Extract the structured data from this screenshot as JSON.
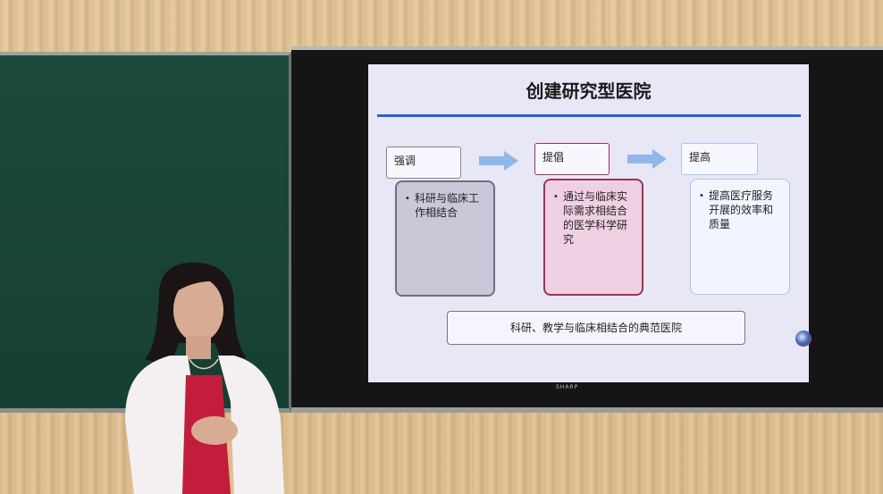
{
  "slide": {
    "title": "创建研究型医院",
    "steps": [
      {
        "label": "强调",
        "content": "科研与临床工作相结合"
      },
      {
        "label": "提倡",
        "content": "通过与临床实际需求相结合的医学科学研究"
      },
      {
        "label": "提高",
        "content": "提高医疗服务开展的效率和质量"
      }
    ],
    "bottom_text": "科研、教学与临床相结合的典范医院"
  },
  "tv": {
    "brand": "SHARP"
  },
  "colors": {
    "slide_background": "#e7e7f5",
    "title_rule": "#2f5fc7",
    "box_1": "#c8c8d8",
    "box_2": "#efd0e2",
    "box_3": "#f2f4ff",
    "arrow": "#90b7ea",
    "chalkboard": "#1d4a3d",
    "jacket": "#f4f0f2",
    "shirt": "#c21e3b"
  },
  "icons": [
    "arrow-right-icon",
    "presentation-logo-icon"
  ]
}
